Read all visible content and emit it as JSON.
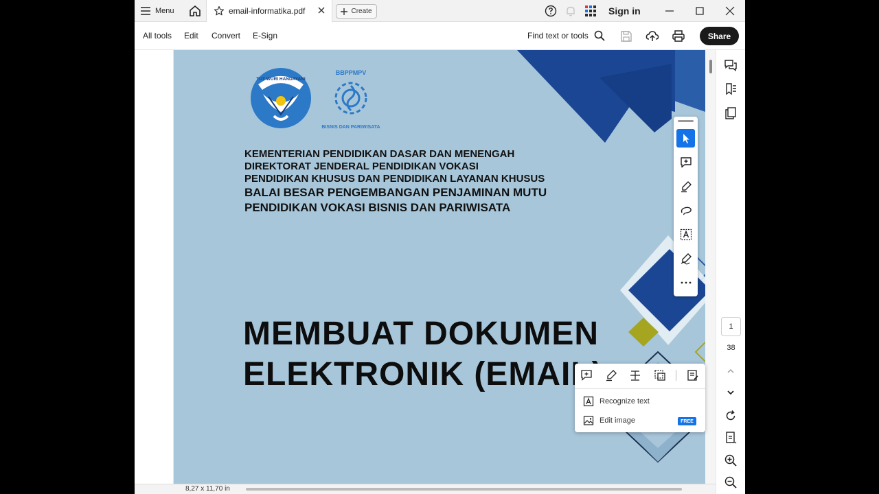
{
  "titlebar": {
    "menu_label": "Menu",
    "tab_title": "email-informatika.pdf",
    "create_label": "Create",
    "sign_in_label": "Sign in"
  },
  "toolbar": {
    "items": [
      "All tools",
      "Edit",
      "Convert",
      "E-Sign"
    ],
    "find_label": "Find text or tools",
    "share_label": "Share"
  },
  "document": {
    "logo_text": [
      "TUT WURI HANDAYANI",
      "BBPPMPV",
      "BISNIS DAN PARIWISATA"
    ],
    "header_lines": [
      "KEMENTERIAN PENDIDIKAN DASAR DAN MENENGAH",
      "DIREKTORAT JENDERAL PENDIDIKAN VOKASI",
      "PENDIDIKAN KHUSUS DAN PENDIDIKAN LAYANAN KHUSUS",
      "BALAI BESAR PENGEMBANGAN PENJAMINAN MUTU",
      "PENDIDIKAN VOKASI BISNIS DAN PARIWISATA"
    ],
    "title_lines": [
      "MEMBUAT DOKUMEN",
      "ELEKTRONIK (EMAIL)"
    ]
  },
  "popup": {
    "recognize_label": "Recognize text",
    "edit_image_label": "Edit image",
    "badge": "FREE"
  },
  "pager": {
    "current_page": "1",
    "total_pages": "38"
  },
  "status": {
    "page_size": "8,27 x 11,70 in"
  },
  "colors": {
    "page_bg": "#a7c6da",
    "navy": "#1f4e9a",
    "accent_blue": "#1473e6",
    "olive": "#a5a520"
  },
  "icons": [
    "menu-icon",
    "home-icon",
    "star-icon",
    "close-icon",
    "plus-icon",
    "help-icon",
    "bell-icon",
    "apps-icon",
    "minimize-icon",
    "maximize-icon",
    "search-icon",
    "save-icon",
    "upload-icon",
    "print-icon",
    "select-cursor-icon",
    "add-comment-icon",
    "highlight-icon",
    "draw-icon",
    "text-box-icon",
    "sign-icon",
    "more-icon",
    "comments-icon",
    "bookmarks-icon",
    "pages-icon",
    "chevron-up-icon",
    "chevron-down-icon",
    "rotate-icon",
    "fit-page-icon",
    "zoom-in-icon",
    "zoom-out-icon",
    "recognize-text-icon",
    "edit-image-icon"
  ]
}
